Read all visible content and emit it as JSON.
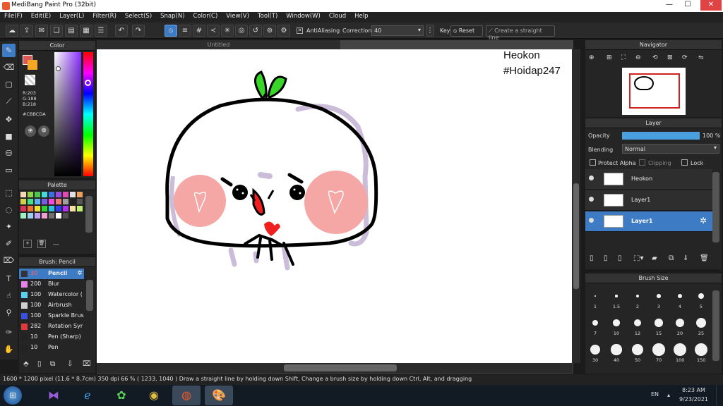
{
  "window": {
    "title": "MediBang Paint Pro (32bit)",
    "min": "—",
    "max": "☐",
    "close": "✕"
  },
  "menu": [
    "File(F)",
    "Edit(E)",
    "Layer(L)",
    "Filter(R)",
    "Select(S)",
    "Snap(N)",
    "Color(C)",
    "View(V)",
    "Tool(T)",
    "Window(W)",
    "Cloud",
    "Help"
  ],
  "toolbar": {
    "antialiasing_label": "AntiAliasing",
    "correction_label": "Correction",
    "correction_value": "40",
    "key_label": "Key",
    "reset_label": "Reset",
    "straight_line_label": "Create a straight line"
  },
  "color_panel": {
    "title": "Color",
    "r": "R:203",
    "g": "G:188",
    "b": "B:218",
    "hex": "#CBBCDA"
  },
  "palette_panel": {
    "title": "Palette",
    "dash_label": "---",
    "swatches": [
      "#f7d9b5",
      "#8fd24a",
      "#4fc64a",
      "#4ad9d9",
      "#3a70e0",
      "#9a4ae0",
      "#e04ab2",
      "#e0e0e0",
      "#f0a05a",
      "#d0d04a",
      "#4ae08a",
      "#5ab0f0",
      "#7a5ae0",
      "#f04ae0",
      "#f07a7a",
      "#a0a0a0",
      "#222222",
      "#555555",
      "#e0305a",
      "#f07030",
      "#f0e030",
      "#30d030",
      "#30c0e0",
      "#3040f0",
      "#b030f0",
      "#f5e0a0",
      "#c0f070",
      "#a0f0c0",
      "#a0d0f0",
      "#c0a0f0",
      "#f0a0d0",
      "#707070",
      "#ffffff",
      "#505050"
    ]
  },
  "brush_panel": {
    "title": "Brush: Pencil",
    "items": [
      {
        "size": "30",
        "name": "Pencil",
        "color": "#333333"
      },
      {
        "size": "200",
        "name": "Blur",
        "color": "#e884e8"
      },
      {
        "size": "100",
        "name": "Watercolor (",
        "color": "#5ad0f0"
      },
      {
        "size": "100",
        "name": "Airbrush",
        "color": "#d0d0d0"
      },
      {
        "size": "100",
        "name": "Sparkle Brus",
        "color": "#3a50e0"
      },
      {
        "size": "282",
        "name": "Rotation Syr",
        "color": "#e03a3a"
      },
      {
        "size": "10",
        "name": "Pen (Sharp)",
        "color": "#222222"
      },
      {
        "size": "10",
        "name": "Pen",
        "color": "#222222"
      }
    ]
  },
  "canvas": {
    "tab_title": "Untitled",
    "text_line1": "Heokon",
    "text_line2": "#Hoidap247"
  },
  "navigator": {
    "title": "Navigator"
  },
  "layer_panel": {
    "title": "Layer",
    "opacity_label": "Opacity",
    "opacity_value": "100 %",
    "opacity_fraction": 1.0,
    "blending_label": "Blending",
    "blending_value": "Normal",
    "protect_alpha": "Protect Alpha",
    "clipping": "Clipping",
    "lock": "Lock",
    "layers": [
      {
        "name": "Heokon",
        "selected": false
      },
      {
        "name": "Layer1",
        "selected": false
      },
      {
        "name": "Layer1",
        "selected": true
      }
    ]
  },
  "brush_size_panel": {
    "title": "Brush Size",
    "sizes": [
      "1",
      "1.5",
      "2",
      "3",
      "4",
      "5",
      "7",
      "10",
      "12",
      "15",
      "20",
      "25",
      "30",
      "40",
      "50",
      "70",
      "100",
      "150"
    ]
  },
  "status": {
    "text": "1600 * 1200 pixel  (11.6 * 8.7cm)  350 dpi  66 %  ( 1233, 1040 )  Draw a straight line by holding down Shift, Change a brush size by holding down Ctrl, Alt, and dragging"
  },
  "taskbar": {
    "lang": "EN",
    "time": "8:23 AM",
    "date": "9/23/2021"
  }
}
